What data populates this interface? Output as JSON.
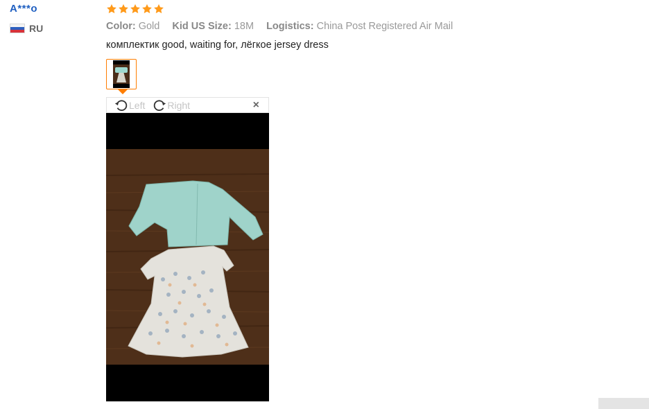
{
  "reviewer": {
    "name": "A***o",
    "country_code": "RU"
  },
  "rating": {
    "stars": 5,
    "max": 5
  },
  "attributes": [
    {
      "label": "Color:",
      "value": "Gold"
    },
    {
      "label": "Kid US Size:",
      "value": "18M"
    },
    {
      "label": "Logistics:",
      "value": "China Post Registered Air Mail"
    }
  ],
  "review_text": "комплектик good, waiting for, лёгкое jersey dress",
  "viewer": {
    "rotate_left_label": "Left",
    "rotate_right_label": "Right",
    "close_label": "×"
  },
  "colors": {
    "accent": "#ff7d00",
    "star": "#ff9a1a",
    "name": "#1f5fc1"
  }
}
